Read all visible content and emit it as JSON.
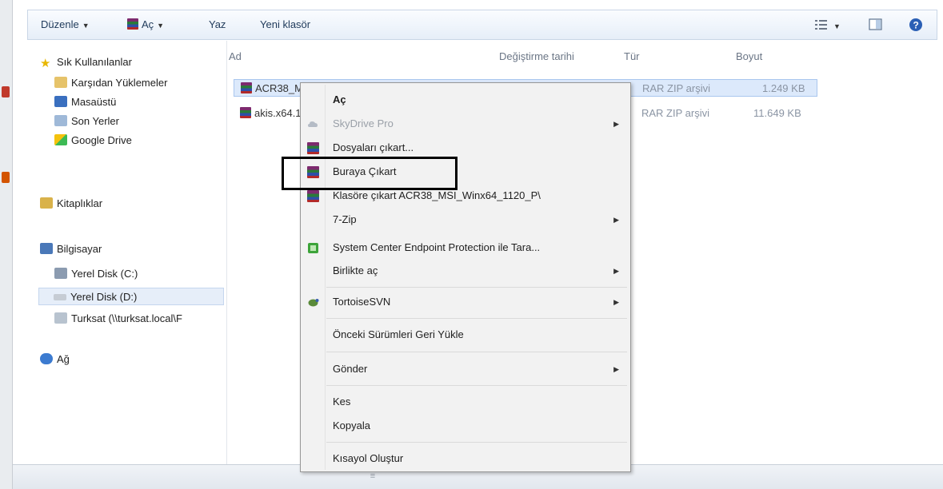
{
  "toolbar": {
    "organize": "Düzenle",
    "open": "Aç",
    "print": "Yaz",
    "new_folder": "Yeni klasör"
  },
  "nav": {
    "favorites": "Sık Kullanılanlar",
    "downloads": "Karşıdan Yüklemeler",
    "desktop": "Masaüstü",
    "recent": "Son Yerler",
    "google_drive": "Google Drive",
    "libraries": "Kitaplıklar",
    "computer": "Bilgisayar",
    "disk_c": "Yerel Disk (C:)",
    "disk_d": "Yerel Disk (D:)",
    "network_drive": "Turksat (\\\\turksat.local\\F",
    "network": "Ağ"
  },
  "columns": {
    "name": "Ad",
    "modified": "Değiştirme tarihi",
    "type": "Tür",
    "size": "Boyut"
  },
  "files": [
    {
      "name": "ACR38_M",
      "type": "RAR ZIP arşivi",
      "size": "1.249 KB"
    },
    {
      "name": "akis.x64.1.",
      "type": "RAR ZIP arşivi",
      "size": "11.649 KB"
    }
  ],
  "menu": {
    "open": "Aç",
    "skydrive": "SkyDrive Pro",
    "extract_files": "Dosyaları çıkart...",
    "extract_here": "Buraya Çıkart",
    "extract_to": "Klasöre çıkart ACR38_MSI_Winx64_1120_P\\",
    "sevenzip": "7-Zip",
    "scep": "System Center Endpoint Protection ile Tara...",
    "open_with": "Birlikte aç",
    "tortoise": "TortoiseSVN",
    "restore": "Önceki Sürümleri Geri Yükle",
    "send_to": "Gönder",
    "cut": "Kes",
    "copy": "Kopyala",
    "shortcut": "Kısayol Oluştur"
  },
  "colors": {
    "accent": "#dce9fb",
    "highlight_box": "#000000"
  }
}
